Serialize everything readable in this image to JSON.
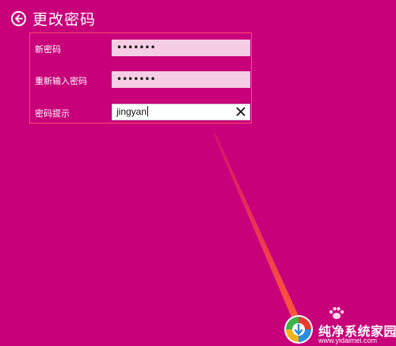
{
  "header": {
    "title": "更改密码",
    "back_icon": "back-arrow-icon"
  },
  "form": {
    "new_password": {
      "label": "新密码",
      "masked_value": "•••••••"
    },
    "confirm_password": {
      "label": "重新输入密码",
      "masked_value": "•••••••"
    },
    "password_hint": {
      "label": "密码提示",
      "value": "jingyan",
      "clear_icon": "close-icon"
    }
  },
  "watermark": {
    "brand": "纯净系统家园",
    "url": "www.yidaimei.com"
  },
  "colors": {
    "background": "#c8007a",
    "form_border": "#ff4a6e",
    "password_field": "#f5cde4",
    "pointer_line": "#ff5a3a"
  }
}
